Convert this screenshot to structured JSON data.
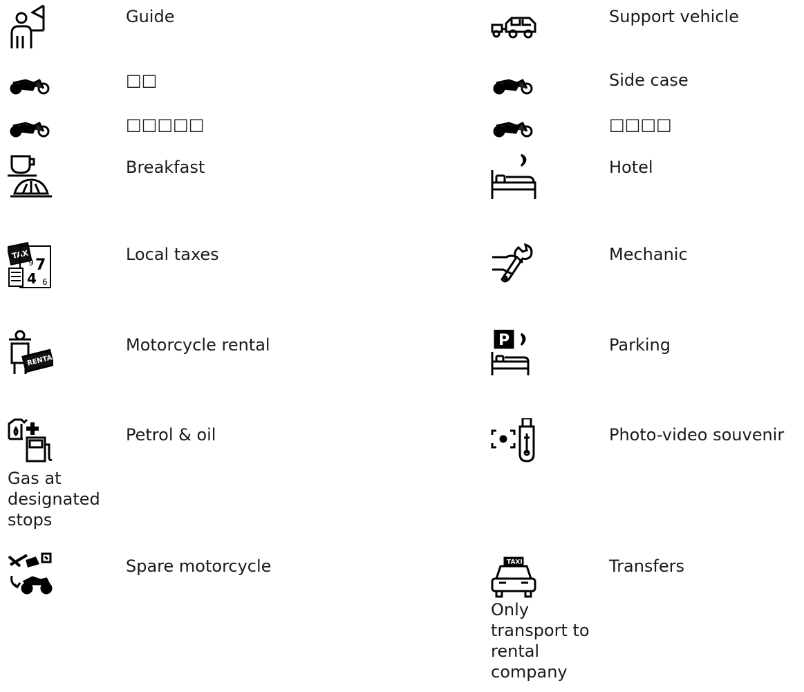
{
  "items": [
    {
      "icon": "tour-guide-icon",
      "label": "Guide",
      "note": ""
    },
    {
      "icon": "support-vehicle-icon",
      "label": "Support vehicle",
      "note": ""
    },
    {
      "icon": "motorcycle-icon",
      "label": "□□",
      "note": ""
    },
    {
      "icon": "motorcycle-icon",
      "label": "Side case",
      "note": ""
    },
    {
      "icon": "motorcycle-icon",
      "label": "□□□□□",
      "note": ""
    },
    {
      "icon": "motorcycle-icon",
      "label": "□□□□",
      "note": ""
    },
    {
      "icon": "coffee-croissant-icon",
      "label": "Breakfast",
      "note": ""
    },
    {
      "icon": "hotel-bed-icon",
      "label": "Hotel",
      "note": ""
    },
    {
      "icon": "tax-calculator-icon",
      "label": "Local taxes",
      "note": ""
    },
    {
      "icon": "mechanic-wrench-icon",
      "label": "Mechanic",
      "note": ""
    },
    {
      "icon": "motorcycle-rental-icon",
      "label": "Motorcycle rental",
      "note": ""
    },
    {
      "icon": "parking-icon",
      "label": "Parking",
      "note": ""
    },
    {
      "icon": "petrol-oil-icon",
      "label": "Petrol & oil",
      "note": "Gas at designated stops"
    },
    {
      "icon": "usb-camera-icon",
      "label": "Photo-video souvenir",
      "note": ""
    },
    {
      "icon": "spare-motorcycle-icon",
      "label": "Spare motorcycle",
      "note": ""
    },
    {
      "icon": "taxi-icon",
      "label": "Transfers",
      "note": "Only transport to rental company"
    }
  ]
}
